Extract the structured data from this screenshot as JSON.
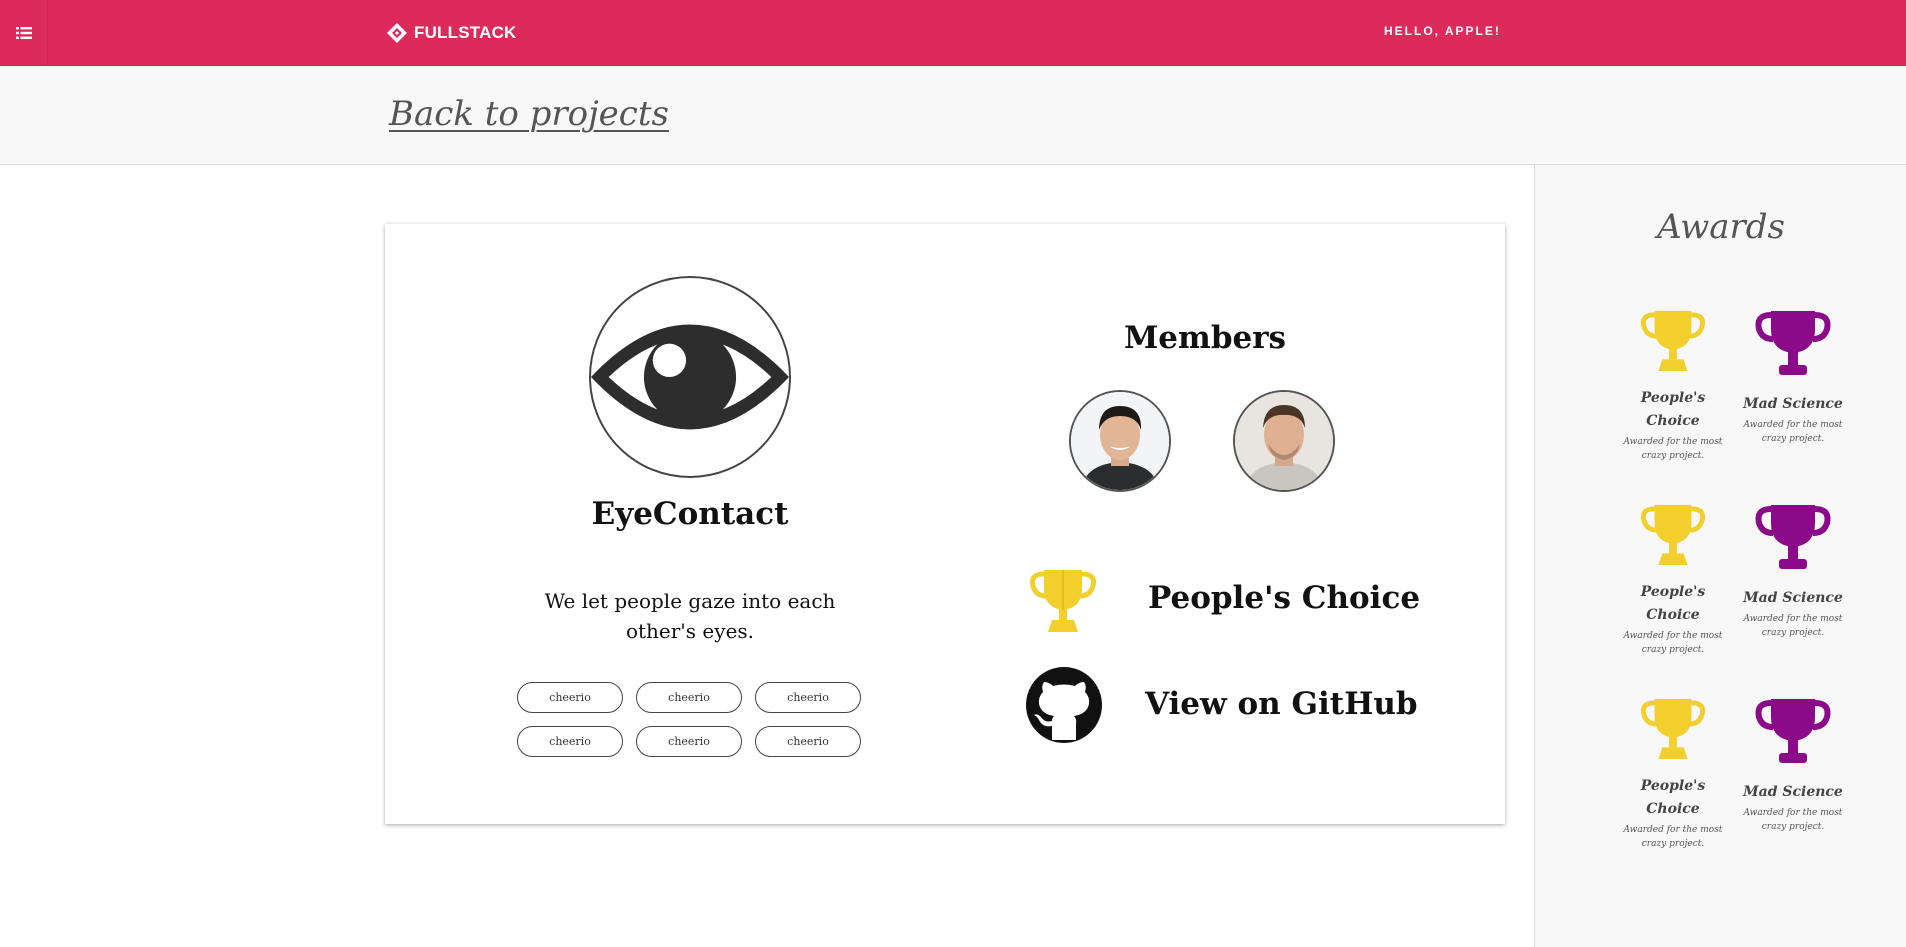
{
  "header": {
    "brand": "FULLSTACK",
    "greeting": "HELLO, APPLE!",
    "menu_icon": "list-icon",
    "brand_color": "#dc2a5a"
  },
  "subheader": {
    "back_link": "Back to projects"
  },
  "project": {
    "name": "EyeContact",
    "description": "We let people gaze into each other's eyes.",
    "tags": [
      "cheerio",
      "cheerio",
      "cheerio",
      "cheerio",
      "cheerio",
      "cheerio"
    ],
    "members_title": "Members",
    "award": "People's Choice",
    "github_label": "View on GitHub"
  },
  "awards_panel": {
    "title": "Awards",
    "items": [
      {
        "name": "People's Choice",
        "desc": "Awarded for the most crazy project.",
        "color": "#f2cf2d"
      },
      {
        "name": "Mad Science",
        "desc": "Awarded for the most crazy project.",
        "color": "#8a0a8a"
      },
      {
        "name": "People's Choice",
        "desc": "Awarded for the most crazy project.",
        "color": "#f2cf2d"
      },
      {
        "name": "Mad Science",
        "desc": "Awarded for the most crazy project.",
        "color": "#8a0a8a"
      },
      {
        "name": "People's Choice",
        "desc": "Awarded for the most crazy project.",
        "color": "#f2cf2d"
      },
      {
        "name": "Mad Science",
        "desc": "Awarded for the most crazy project.",
        "color": "#8a0a8a"
      }
    ]
  }
}
